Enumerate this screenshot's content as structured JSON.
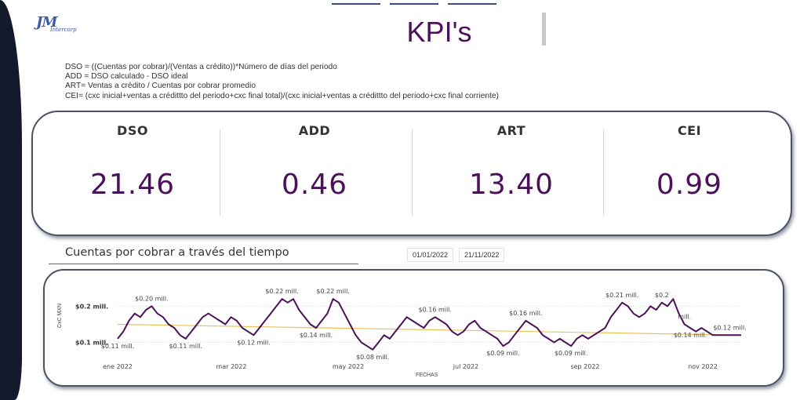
{
  "logo": {
    "mark": "JM",
    "sub": "Intercorp"
  },
  "page": {
    "title": "KPI's"
  },
  "definitions": [
    "DSO = ((Cuentas por cobrar)/(Ventas a crédito))*Número de días del periodo",
    "ADD = DSO calculado - DSO ideal",
    "ART= Ventas a crédito / Cuentas por cobrar promedio",
    "CEI= (cxc inicial+ventas a crédittto  del periodo+cxc final total)/(cxc inicial+ventas a crédittto del  periodo+cxc final corriente)"
  ],
  "kpis": [
    {
      "label": "DSO",
      "value": "21.46"
    },
    {
      "label": "ADD",
      "value": "0.46"
    },
    {
      "label": "ART",
      "value": "13.40"
    },
    {
      "label": "CEI",
      "value": "0.99"
    }
  ],
  "section": {
    "title": "Cuentas por cobrar a través del tiempo"
  },
  "date_filter": {
    "start": "01/01/2022",
    "end": "21/11/2022"
  },
  "colors": {
    "accent": "#4b1159",
    "trend": "#e8c35a",
    "frame": "#4a5266"
  },
  "chart_data": {
    "type": "line",
    "xlabel": "FECHAS",
    "ylabel": "CxC MXN",
    "x_tick_labels": [
      "ene 2022",
      "mar 2022",
      "may 2022",
      "jul 2022",
      "sep 2022",
      "nov 2022"
    ],
    "y_tick_labels": [
      "$0.1 mill.",
      "$0.2 mill."
    ],
    "ylim": [
      0.06,
      0.24
    ],
    "grid": true,
    "series": [
      {
        "values": [
          0.11,
          0.13,
          0.16,
          0.18,
          0.17,
          0.19,
          0.2,
          0.18,
          0.17,
          0.15,
          0.14,
          0.12,
          0.11,
          0.13,
          0.15,
          0.17,
          0.18,
          0.17,
          0.16,
          0.15,
          0.17,
          0.16,
          0.14,
          0.13,
          0.12,
          0.14,
          0.16,
          0.18,
          0.2,
          0.22,
          0.21,
          0.22,
          0.19,
          0.17,
          0.15,
          0.14,
          0.16,
          0.18,
          0.22,
          0.21,
          0.18,
          0.15,
          0.12,
          0.1,
          0.09,
          0.08,
          0.1,
          0.12,
          0.11,
          0.13,
          0.15,
          0.17,
          0.16,
          0.15,
          0.14,
          0.16,
          0.17,
          0.16,
          0.15,
          0.13,
          0.12,
          0.13,
          0.15,
          0.16,
          0.14,
          0.13,
          0.12,
          0.11,
          0.09,
          0.1,
          0.12,
          0.14,
          0.16,
          0.15,
          0.14,
          0.12,
          0.11,
          0.1,
          0.11,
          0.1,
          0.09,
          0.11,
          0.12,
          0.11,
          0.12,
          0.13,
          0.14,
          0.17,
          0.19,
          0.21,
          0.2,
          0.18,
          0.17,
          0.18,
          0.2,
          0.19,
          0.21,
          0.2,
          0.22,
          0.18,
          0.15,
          0.14,
          0.13,
          0.14,
          0.13,
          0.12,
          0.12,
          0.12,
          0.12,
          0.12,
          0.12
        ],
        "labels": [
          {
            "i": 0,
            "text": "$0.11 mill.",
            "pos": "below"
          },
          {
            "i": 6,
            "text": "$0.20 mill.",
            "pos": "above"
          },
          {
            "i": 12,
            "text": "$0.11 mill.",
            "pos": "below"
          },
          {
            "i": 24,
            "text": "$0.12 mill.",
            "pos": "below"
          },
          {
            "i": 29,
            "text": "$0.22 mill.",
            "pos": "above"
          },
          {
            "i": 35,
            "text": "$0.14 mill.",
            "pos": "below"
          },
          {
            "i": 38,
            "text": "$0.22 mill.",
            "pos": "above"
          },
          {
            "i": 45,
            "text": "$0.08 mill.",
            "pos": "below"
          },
          {
            "i": 56,
            "text": "$0.16 mill.",
            "pos": "above"
          },
          {
            "i": 68,
            "text": "$0.09 mill.",
            "pos": "below"
          },
          {
            "i": 72,
            "text": "$0.16 mill.",
            "pos": "above"
          },
          {
            "i": 80,
            "text": "$0.09 mill.",
            "pos": "below"
          },
          {
            "i": 89,
            "text": "$0.21 mill.",
            "pos": "above"
          },
          {
            "i": 96,
            "text": "$0.2",
            "pos": "above"
          },
          {
            "i": 100,
            "text": "mill.",
            "pos": "above"
          },
          {
            "i": 101,
            "text": "$0.14 mill.",
            "pos": "below"
          },
          {
            "i": 108,
            "text": "$0.12 mill.",
            "pos": "above"
          }
        ]
      },
      {
        "name": "",
        "kind": "trend",
        "values": [
          0.15,
          0.12
        ]
      }
    ]
  }
}
